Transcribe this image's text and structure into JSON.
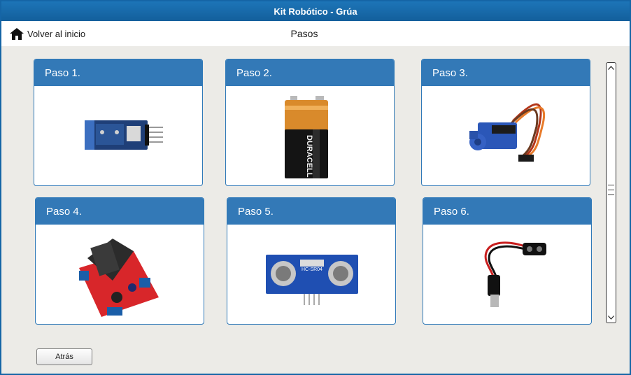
{
  "window": {
    "title": "Kit Robótico - Grúa"
  },
  "nav": {
    "home_label": "Volver al inicio",
    "page_title": "Pasos"
  },
  "steps": [
    {
      "label": "Paso 1.",
      "image": "bluetooth-module"
    },
    {
      "label": "Paso 2.",
      "image": "duracell-9v-battery",
      "brand": "DURACELL"
    },
    {
      "label": "Paso 3.",
      "image": "servo-motor"
    },
    {
      "label": "Paso 4.",
      "image": "motor-driver-board"
    },
    {
      "label": "Paso 5.",
      "image": "ultrasonic-sensor",
      "model": "HC-SR04"
    },
    {
      "label": "Paso 6.",
      "image": "battery-clip-connector"
    }
  ],
  "footer": {
    "back_label": "Atrás"
  },
  "colors": {
    "titlebar": "#1565a6",
    "card_header": "#3379b7",
    "background": "#ecebe7"
  }
}
